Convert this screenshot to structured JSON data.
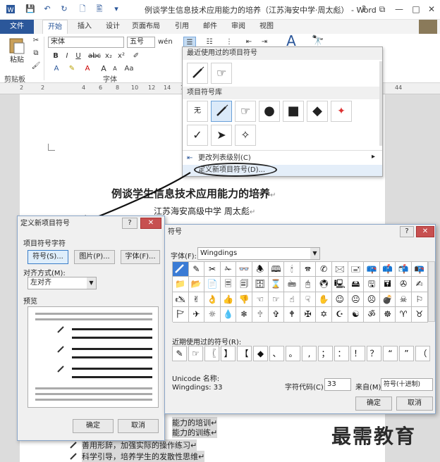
{
  "window": {
    "title": "例谈学生信息技术应用能力的培养（江苏海安中学·周太彪） - Word",
    "help": "?",
    "min": "—",
    "restore": "□",
    "close": "✕"
  },
  "tabs": [
    "文件",
    "开始",
    "插入",
    "设计",
    "页面布局",
    "引用",
    "邮件",
    "审阅",
    "视图"
  ],
  "ribbon": {
    "paste": "粘贴",
    "clipboard_group": "剪贴板",
    "font_group": "字体",
    "font_name": "宋体",
    "font_size": "五号",
    "bold": "B",
    "italic": "I",
    "underline": "U",
    "strike": "abc",
    "sub": "x₂",
    "sup": "x²",
    "grow": "A",
    "shrink": "A",
    "aa": "Aa",
    "wen": "wén"
  },
  "ruler": [
    "2",
    "2",
    "4",
    "6",
    "8",
    "10",
    "12",
    "14",
    "16",
    "44"
  ],
  "gallery": {
    "recent_header": "最近使用过的项目符号",
    "library_header": "项目符号库",
    "none_label": "无",
    "change_level": "更改列表级别(C)",
    "define_new": "定义新项目符号(D)...",
    "arrow": "▸"
  },
  "document": {
    "title": "例谈学生信息技术应用能力的培养",
    "author": "江苏海安高级中学  周太彪",
    "mark": "↵",
    "lines": [
      "能力的培训↵",
      "能力的训练↵",
      "善用形辞，加强实际的操作练习↵",
      "科学引导，培养学生的发散性思维↵"
    ]
  },
  "define_dialog": {
    "title": "定义新项目符号",
    "help": "?",
    "close": "✕",
    "bullet_char": "项目符号字符",
    "symbol_btn": "符号(S)...",
    "picture_btn": "图片(P)...",
    "font_btn": "字体(F)...",
    "alignment_label": "对齐方式(M):",
    "alignment_value": "左对齐",
    "preview_label": "预览",
    "ok": "确定",
    "cancel": "取消"
  },
  "symbol_dialog": {
    "title": "符号",
    "help": "?",
    "close": "✕",
    "font_label": "字体(F):",
    "font_value": "Wingdings",
    "symbols": [
      "",
      "✎",
      "✂",
      "✁",
      "👓",
      "🕭",
      "🕮",
      "🕯",
      "🕿",
      "✆",
      "🖂",
      "🖃",
      "📪",
      "📫",
      "📬",
      "📭",
      "📁",
      "📂",
      "📄",
      "🗏",
      "🗐",
      "🗄",
      "⌛",
      "🖮",
      "🖰",
      "🖲",
      "🖳",
      "🖴",
      "🖫",
      "🖬",
      "✇",
      "✍",
      "🖎",
      "✌",
      "👌",
      "👍",
      "👎",
      "☜",
      "☞",
      "☝",
      "☟",
      "✋",
      "☺",
      "😐",
      "☹",
      "💣",
      "☠",
      "⚐",
      "🏱",
      "✈",
      "☼",
      "💧",
      "❄",
      "🕆",
      "✞",
      "🕈",
      "✠",
      "✡",
      "☪",
      "☯",
      "ॐ",
      "☸",
      "♈",
      "♉"
    ],
    "recent_label": "近期使用过的符号(R):",
    "recent": [
      "✎",
      "☞",
      "〖",
      "】",
      "【",
      "◆",
      "、",
      "。",
      ",",
      "；",
      "：",
      "！",
      "？",
      "“",
      "”",
      "（"
    ],
    "unicode_name_label": "Unicode 名称:",
    "unicode_name_value": "Wingdings: 33",
    "char_code_label": "字符代码(C):",
    "char_code_value": "33",
    "from_label": "来自(M):",
    "from_value": "符号(十进制)",
    "ok": "确定",
    "cancel": "取消"
  },
  "watermark": "最需教育",
  "colors": {
    "accent": "#2b579a",
    "select": "#3a7bd5"
  }
}
